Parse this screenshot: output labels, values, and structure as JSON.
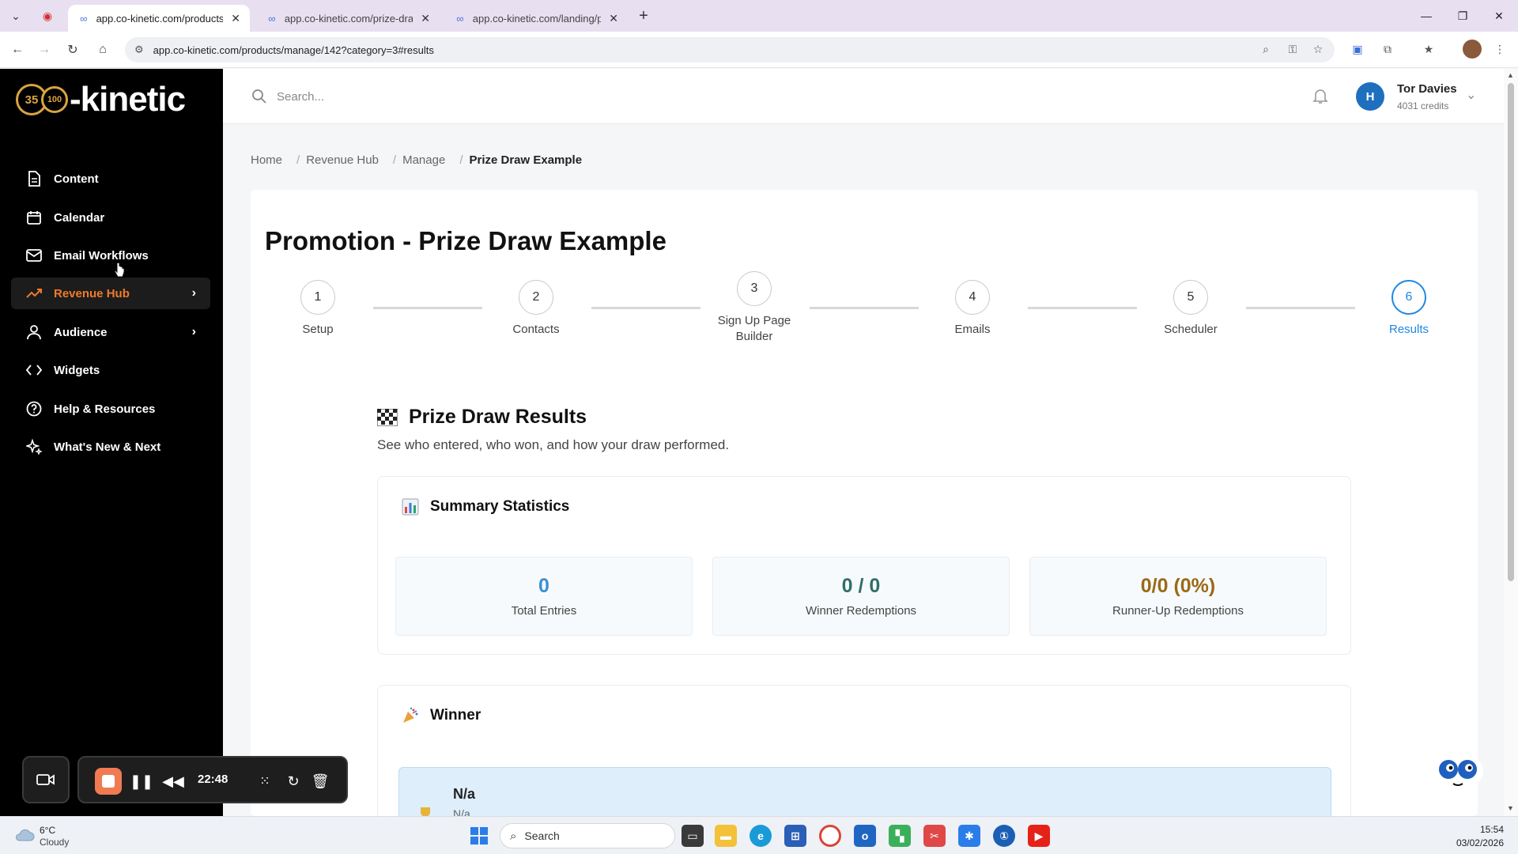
{
  "browser": {
    "tabs": [
      {
        "title": "app.co-kinetic.com/products/m",
        "active": true
      },
      {
        "title": "app.co-kinetic.com/prize-draw",
        "active": false
      },
      {
        "title": "app.co-kinetic.com/landing/pr",
        "active": false
      }
    ],
    "url": "app.co-kinetic.com/products/manage/142?category=3#results"
  },
  "sidebar": {
    "logo_badge": "35",
    "logo_badge2": "100",
    "logo_text": "-kinetic",
    "items": [
      {
        "label": "Content",
        "icon": "document-icon"
      },
      {
        "label": "Calendar",
        "icon": "calendar-icon"
      },
      {
        "label": "Email Workflows",
        "icon": "mail-icon"
      },
      {
        "label": "Revenue Hub",
        "icon": "trending-up-icon",
        "active": true,
        "has_children": true
      },
      {
        "label": "Audience",
        "icon": "user-icon",
        "has_children": true
      },
      {
        "label": "Widgets",
        "icon": "code-icon"
      },
      {
        "label": "Help & Resources",
        "icon": "help-icon"
      },
      {
        "label": "What's New & Next",
        "icon": "sparkle-icon"
      }
    ]
  },
  "header": {
    "search_placeholder": "Search...",
    "user_initial": "H",
    "user_name": "Tor Davies",
    "user_credits": "4031 credits"
  },
  "breadcrumb": [
    "Home",
    "Revenue Hub",
    "Manage",
    "Prize Draw Example"
  ],
  "page": {
    "title": "Promotion - Prize Draw Example",
    "steps": [
      {
        "number": "1",
        "label": "Setup"
      },
      {
        "number": "2",
        "label": "Contacts"
      },
      {
        "number": "3",
        "label": "Sign Up Page Builder"
      },
      {
        "number": "4",
        "label": "Emails"
      },
      {
        "number": "5",
        "label": "Scheduler"
      },
      {
        "number": "6",
        "label": "Results",
        "active": true
      }
    ],
    "results_title": "Prize Draw Results",
    "results_subtitle": "See who entered, who won, and how your draw performed.",
    "summary": {
      "title": "Summary Statistics",
      "stats": [
        {
          "value": "0",
          "label": "Total Entries",
          "color": "#3b8fd0"
        },
        {
          "value": "0 / 0",
          "label": "Winner Redemptions",
          "color": "#2f6f68"
        },
        {
          "value": "0/0 (0%)",
          "label": "Runner-Up Redemptions",
          "color": "#9a6a17"
        }
      ]
    },
    "winner": {
      "title": "Winner",
      "name": "N/a",
      "sub": "N/a"
    }
  },
  "recorder": {
    "time": "22:48"
  },
  "taskbar": {
    "weather_temp": "6°C",
    "weather_desc": "Cloudy",
    "search_label": "Search",
    "time": "15:54",
    "date": "03/02/2026"
  },
  "colors": {
    "accent": "#1e88e5",
    "sidebar_active": "#f07a2b",
    "avatar": "#1f6fbf"
  }
}
